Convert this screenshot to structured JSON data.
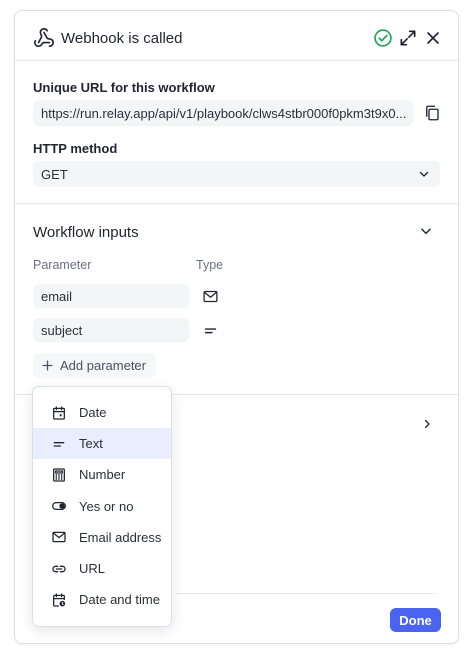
{
  "header": {
    "title": "Webhook is called",
    "icons": [
      "webhook-icon",
      "check-circle-icon",
      "expand-icon",
      "close-icon"
    ]
  },
  "url_section": {
    "label": "Unique URL for this workflow",
    "value": "https://run.relay.app/api/v1/playbook/clws4stbr000f0pkm3t9x0..."
  },
  "method_section": {
    "label": "HTTP method",
    "value": "GET"
  },
  "workflow_inputs": {
    "title": "Workflow inputs",
    "col_parameter": "Parameter",
    "col_type": "Type",
    "params": [
      {
        "name": "email",
        "type_icon": "mail-icon"
      },
      {
        "name": "subject",
        "type_icon": "text-lines-icon"
      }
    ],
    "add_label": "Add parameter"
  },
  "type_menu": {
    "items": [
      {
        "label": "Date",
        "icon": "calendar-icon"
      },
      {
        "label": "Text",
        "icon": "text-lines-icon",
        "selected": true
      },
      {
        "label": "Number",
        "icon": "calculator-icon"
      },
      {
        "label": "Yes or no",
        "icon": "toggle-icon"
      },
      {
        "label": "Email address",
        "icon": "mail-icon"
      },
      {
        "label": "URL",
        "icon": "link-icon"
      },
      {
        "label": "Date and time",
        "icon": "calendar-clock-icon"
      }
    ]
  },
  "footer": {
    "done_label": "Done"
  },
  "colors": {
    "accent": "#4a63f0",
    "success": "#22a35a",
    "selected_bg": "#e9edfd"
  }
}
